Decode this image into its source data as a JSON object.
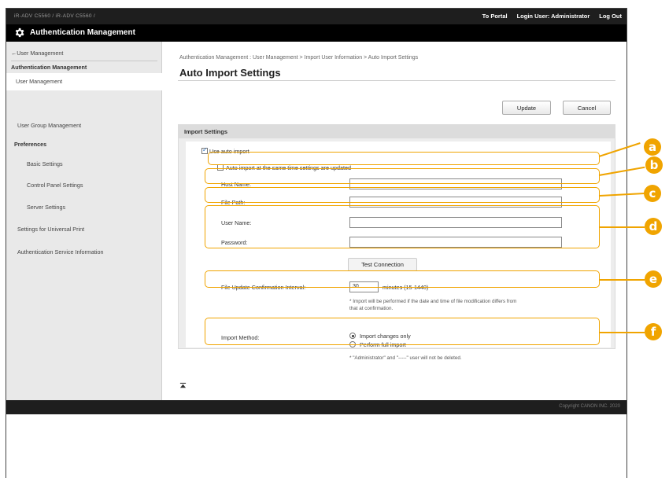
{
  "topbar": {
    "device_info": "iR-ADV C5560 / iR-ADV C5560 /",
    "to_portal": "To Portal",
    "login_user_label": "Login User:",
    "login_user_value": "Administrator",
    "logout": "Log Out"
  },
  "app": {
    "title": "Authentication Management"
  },
  "sidebar": {
    "back": "←User Management",
    "section_auth": "Authentication Management",
    "user_management": "User Management",
    "user_group_management": "User Group Management",
    "section_preferences": "Preferences",
    "basic_settings": "Basic Settings",
    "control_panel_settings": "Control Panel Settings",
    "server_settings": "Server Settings",
    "universal_print": "Settings for Universal Print",
    "auth_service_info": "Authentication Service Information"
  },
  "main": {
    "breadcrumb": "Authentication Management : User Management > Import User Information > Auto Import Settings",
    "page_title": "Auto Import Settings",
    "update_button": "Update",
    "cancel_button": "Cancel",
    "panel_title": "Import Settings",
    "use_auto_import": "Use auto import",
    "auto_import_same_time": "Auto import at the same time settings are updated",
    "host_name_label": "Host Name:",
    "host_name_value": "",
    "file_path_label": "File Path:",
    "file_path_value": "",
    "user_name_label": "User Name:",
    "user_name_value": "",
    "password_label": "Password:",
    "password_value": "",
    "test_connection": "Test Connection",
    "interval_label": "File Update Confirmation Interval:",
    "interval_value": "30",
    "interval_unit": "minutes (15-1440)",
    "interval_note_1": "* Import will be performed if the date and time of file modification differs from",
    "interval_note_2": "that at confirmation.",
    "import_method_label": "Import Method:",
    "import_changes_only": "Import changes only",
    "perform_full_import": "Perform full import",
    "method_note": "* \"Administrator\" and \"-----\" user will not be deleted.",
    "to_top": "↑"
  },
  "footer": {
    "copyright": "Copyright CANON INC. 2020"
  },
  "callouts": [
    "a",
    "b",
    "c",
    "d",
    "e",
    "f"
  ],
  "colors": {
    "callout": "#f0a400",
    "titlebar": "#000000",
    "topbar": "#1e1e1e"
  },
  "icons": {
    "title": "gear-icon",
    "to_top": "arrow-to-top-icon"
  }
}
